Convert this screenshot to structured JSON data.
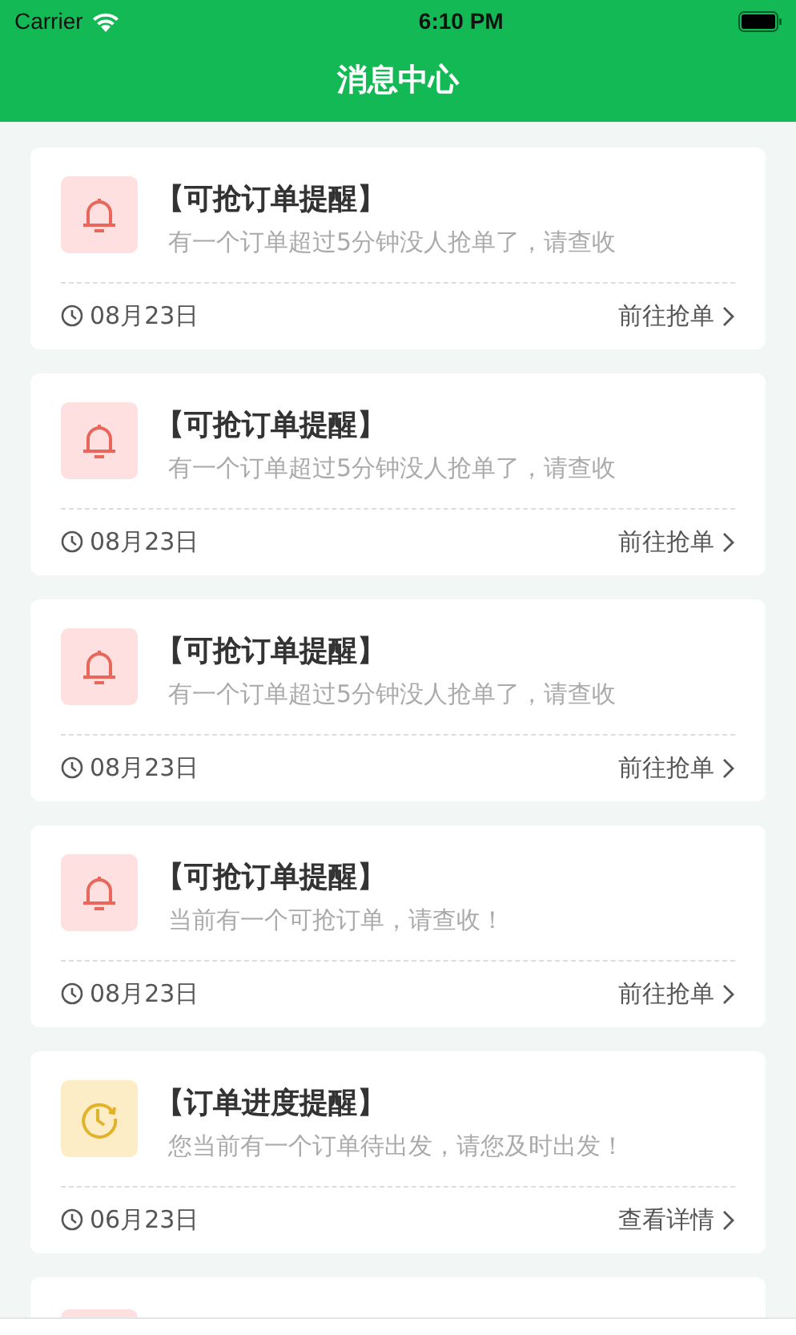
{
  "status_bar": {
    "carrier": "Carrier",
    "time": "6:10 PM"
  },
  "nav": {
    "title": "消息中心"
  },
  "messages": [
    {
      "kind": "grab",
      "title": "【可抢订单提醒】",
      "body": "有一个订单超过5分钟没人抢单了，请查收",
      "date": "08月23日",
      "action": "前往抢单"
    },
    {
      "kind": "grab",
      "title": "【可抢订单提醒】",
      "body": "有一个订单超过5分钟没人抢单了，请查收",
      "date": "08月23日",
      "action": "前往抢单"
    },
    {
      "kind": "grab",
      "title": "【可抢订单提醒】",
      "body": "有一个订单超过5分钟没人抢单了，请查收",
      "date": "08月23日",
      "action": "前往抢单"
    },
    {
      "kind": "grab",
      "title": "【可抢订单提醒】",
      "body": "当前有一个可抢订单，请查收！",
      "date": "08月23日",
      "action": "前往抢单"
    },
    {
      "kind": "progress",
      "title": "【订单进度提醒】",
      "body": "您当前有一个订单待出发，请您及时出发！",
      "date": "06月23日",
      "action": "查看详情"
    },
    {
      "kind": "grab"
    }
  ]
}
